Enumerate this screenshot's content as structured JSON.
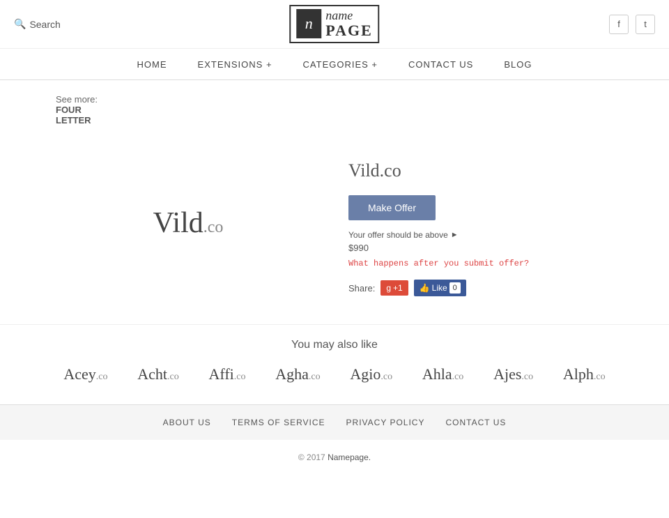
{
  "header": {
    "search_label": "Search",
    "logo_icon": "n",
    "logo_name": "name",
    "logo_page": "PAGE",
    "facebook_icon": "f",
    "twitter_icon": "t"
  },
  "nav": {
    "items": [
      {
        "label": "HOME",
        "has_dropdown": false
      },
      {
        "label": "EXTENSIONS +",
        "has_dropdown": true
      },
      {
        "label": "CATEGORIES +",
        "has_dropdown": true
      },
      {
        "label": "CONTACT US",
        "has_dropdown": false
      },
      {
        "label": "BLOG",
        "has_dropdown": false
      }
    ]
  },
  "breadcrumb": {
    "prefix": "See more:",
    "link_text": "FOUR",
    "link_text2": "LETTER"
  },
  "domain": {
    "name": "Vild",
    "ext": ".co",
    "full": "Vild.co",
    "make_offer_label": "Make Offer",
    "offer_hint": "Your offer should be above",
    "offer_amount": "$990",
    "what_happens_link": "What happens after you submit offer?",
    "share_label": "Share:",
    "gplus_label": "g+1",
    "fb_like_label": "Like",
    "fb_count": "0"
  },
  "also_like": {
    "title": "You may also like",
    "items": [
      {
        "name": "Acey",
        "ext": ".co"
      },
      {
        "name": "Acht",
        "ext": ".co"
      },
      {
        "name": "Affi",
        "ext": ".co"
      },
      {
        "name": "Agha",
        "ext": ".co"
      },
      {
        "name": "Agio",
        "ext": ".co"
      },
      {
        "name": "Ahla",
        "ext": ".co"
      },
      {
        "name": "Ajes",
        "ext": ".co"
      },
      {
        "name": "Alph",
        "ext": ".co"
      }
    ]
  },
  "footer": {
    "nav_items": [
      {
        "label": "ABOUT US"
      },
      {
        "label": "TERMS OF SERVICE"
      },
      {
        "label": "PRIVACY POLICY"
      },
      {
        "label": "CONTACT US"
      }
    ],
    "copyright": "© 2017",
    "copyright_link": "Namepage."
  }
}
